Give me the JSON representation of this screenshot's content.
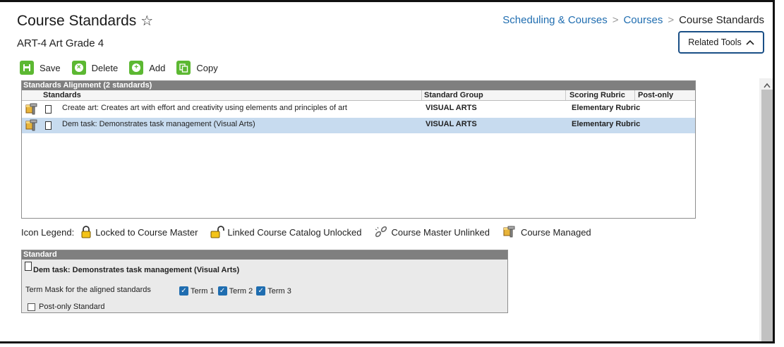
{
  "header": {
    "title": "Course Standards",
    "favorite_icon": "star-outline-icon",
    "subtitle": "ART-4 Art Grade 4",
    "breadcrumb": [
      {
        "label": "Scheduling & Courses",
        "link": true
      },
      {
        "label": "Courses",
        "link": true
      },
      {
        "label": "Course Standards",
        "link": false
      }
    ],
    "breadcrumb_sep": ">",
    "related_tools_label": "Related Tools",
    "related_tools_icon": "chevron-up-icon"
  },
  "toolbar": {
    "save_label": "Save",
    "delete_label": "Delete",
    "add_label": "Add",
    "copy_label": "Copy"
  },
  "grid": {
    "title": "Standards Alignment (2 standards)",
    "columns": [
      "Standards",
      "Standard Group",
      "Scoring Rubric",
      "Post-only"
    ],
    "rows": [
      {
        "standard": "Create art: Creates art with effort and creativity using elements and principles of art",
        "group": "VISUAL ARTS",
        "rubric": "Elementary Rubric",
        "post_only": "",
        "selected": false
      },
      {
        "standard": "Dem task: Demonstrates task management (Visual Arts)",
        "group": "VISUAL ARTS",
        "rubric": "Elementary Rubric",
        "post_only": "",
        "selected": true
      }
    ]
  },
  "legend": {
    "label": "Icon Legend:",
    "items": [
      {
        "icon": "lock-icon",
        "label": "Locked to Course Master"
      },
      {
        "icon": "unlock-icon",
        "label": "Linked Course Catalog Unlocked"
      },
      {
        "icon": "broken-link-icon",
        "label": "Course Master Unlinked"
      },
      {
        "icon": "course-managed-icon",
        "label": "Course Managed"
      }
    ]
  },
  "standard_panel": {
    "title": "Standard",
    "name": "Dem task: Demonstrates task management (Visual Arts)",
    "term_mask_label": "Term Mask for the aligned standards",
    "terms": [
      {
        "label": "Term 1",
        "checked": true
      },
      {
        "label": "Term 2",
        "checked": true
      },
      {
        "label": "Term 3",
        "checked": true
      }
    ],
    "post_only_label": "Post-only Standard",
    "post_only_checked": false
  },
  "colors": {
    "accent": "#1f6db0",
    "toolbar_green": "#5cb832",
    "header_gray": "#7f7f7f",
    "selected_row": "#c7dbef"
  }
}
